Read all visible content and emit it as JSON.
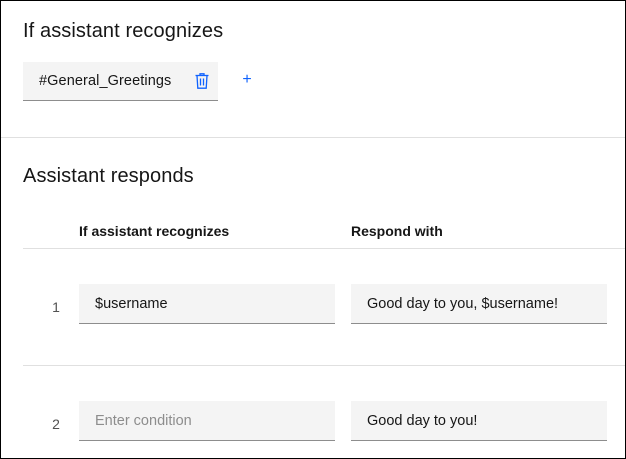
{
  "condition": {
    "heading": "If assistant recognizes",
    "tags": [
      "#General_Greetings"
    ],
    "delete_icon": "trash-icon",
    "add_icon": "plus-icon",
    "add_label": "+"
  },
  "responses": {
    "heading": "Assistant responds",
    "columns": {
      "condition": "If assistant recognizes",
      "response": "Respond with"
    },
    "rows": [
      {
        "number": "1",
        "condition_value": "$username",
        "condition_placeholder": "Enter condition",
        "response_value": "Good day to you, $username!"
      },
      {
        "number": "2",
        "condition_value": "",
        "condition_placeholder": "Enter condition",
        "response_value": "Good day to you!"
      }
    ]
  },
  "colors": {
    "accent": "#0f62fe",
    "field_bg": "#f4f4f4",
    "divider": "#e0e0e0"
  }
}
